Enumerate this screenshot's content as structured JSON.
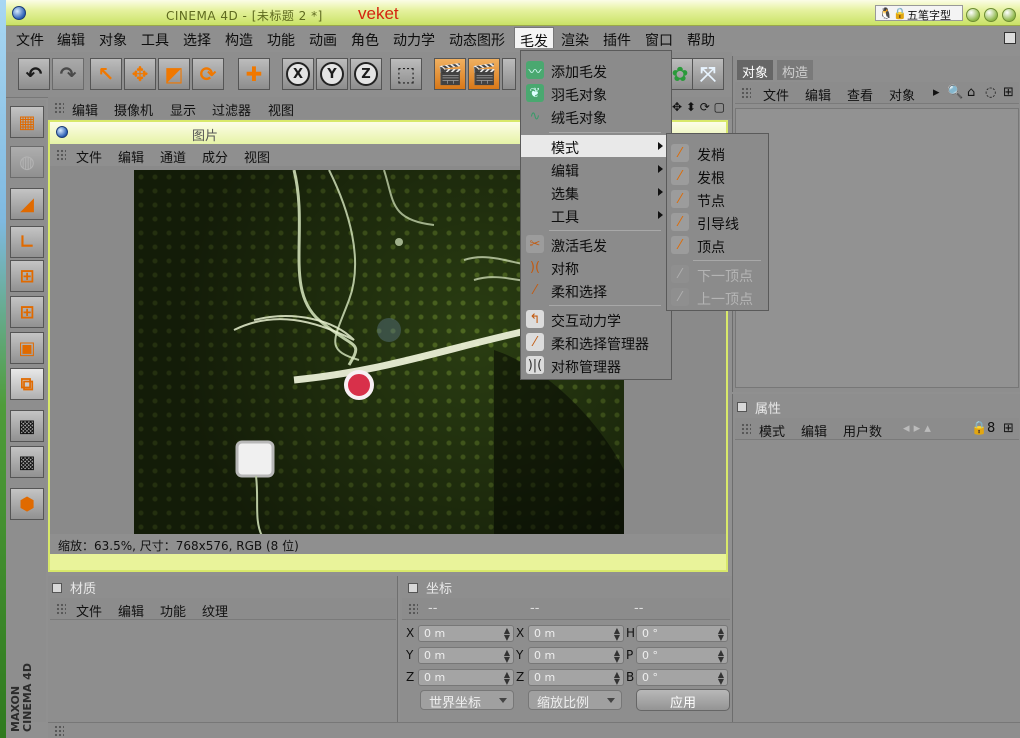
{
  "window": {
    "title": "CINEMA 4D - [未标题 2 *]",
    "watermark": "veket",
    "ime_label": "五笔字型"
  },
  "menubar": {
    "items": [
      "文件",
      "编辑",
      "对象",
      "工具",
      "选择",
      "构造",
      "功能",
      "动画",
      "角色",
      "动力学",
      "动态图形",
      "毛发",
      "渲染",
      "插件",
      "窗口",
      "帮助"
    ],
    "active": "毛发"
  },
  "viewport_menu": [
    "编辑",
    "摄像机",
    "显示",
    "过滤器",
    "视图"
  ],
  "picture_viewer": {
    "title": "图片",
    "menu": [
      "文件",
      "编辑",
      "通道",
      "成分",
      "视图"
    ],
    "status": "缩放：63.5%, 尺寸：768x576, RGB (8 位)"
  },
  "hair_menu": {
    "items": [
      {
        "label": "添加毛发",
        "icon": "add-hair-icon"
      },
      {
        "label": "羽毛对象",
        "icon": "feather-icon"
      },
      {
        "label": "绒毛对象",
        "icon": "fur-icon"
      },
      {
        "label": "模式",
        "submenu": true
      },
      {
        "label": "编辑",
        "submenu": true
      },
      {
        "label": "选集",
        "submenu": true
      },
      {
        "label": "工具",
        "submenu": true
      },
      {
        "label": "激活毛发",
        "icon": "activate-hair-icon"
      },
      {
        "label": "对称",
        "icon": "symmetry-icon"
      },
      {
        "label": "柔和选择",
        "icon": "soft-selection-icon"
      },
      {
        "label": "交互动力学",
        "icon": "interactive-dynamics-icon"
      },
      {
        "label": "柔和选择管理器",
        "icon": "soft-selection-manager-icon"
      },
      {
        "label": "对称管理器",
        "icon": "symmetry-manager-icon"
      }
    ]
  },
  "mode_submenu": {
    "items": [
      {
        "label": "发梢",
        "enabled": true
      },
      {
        "label": "发根",
        "enabled": true
      },
      {
        "label": "节点",
        "enabled": true
      },
      {
        "label": "引导线",
        "enabled": true
      },
      {
        "label": "顶点",
        "enabled": true
      },
      {
        "label": "下一顶点",
        "enabled": false
      },
      {
        "label": "上一顶点",
        "enabled": false
      }
    ]
  },
  "object_panel": {
    "tabs": [
      "对象",
      "构造"
    ],
    "menu": [
      "文件",
      "编辑",
      "查看",
      "对象"
    ]
  },
  "attribute_panel": {
    "title": "属性",
    "menu": [
      "模式",
      "编辑",
      "用户数"
    ]
  },
  "material_panel": {
    "title": "材质",
    "menu": [
      "文件",
      "编辑",
      "功能",
      "纹理"
    ]
  },
  "coord_panel": {
    "title": "坐标",
    "col_headers": [
      "--",
      "--",
      "--"
    ],
    "rows": [
      {
        "l1": "X",
        "v1": "0 m",
        "l2": "X",
        "v2": "0 m",
        "l3": "H",
        "v3": "0 °"
      },
      {
        "l1": "Y",
        "v1": "0 m",
        "l2": "Y",
        "v2": "0 m",
        "l3": "P",
        "v3": "0 °"
      },
      {
        "l1": "Z",
        "v1": "0 m",
        "l2": "Z",
        "v2": "0 m",
        "l3": "B",
        "v3": "0 °"
      }
    ],
    "mode_select": "世界坐标",
    "scale_select": "缩放比例",
    "apply_label": "应用"
  },
  "logo": {
    "line1": "MAXON",
    "line2": "CINEMA 4D"
  },
  "colors": {
    "accent_menu": "#e9e9e9",
    "titlebar": "#e6f2a0",
    "watermark": "#d42410"
  }
}
